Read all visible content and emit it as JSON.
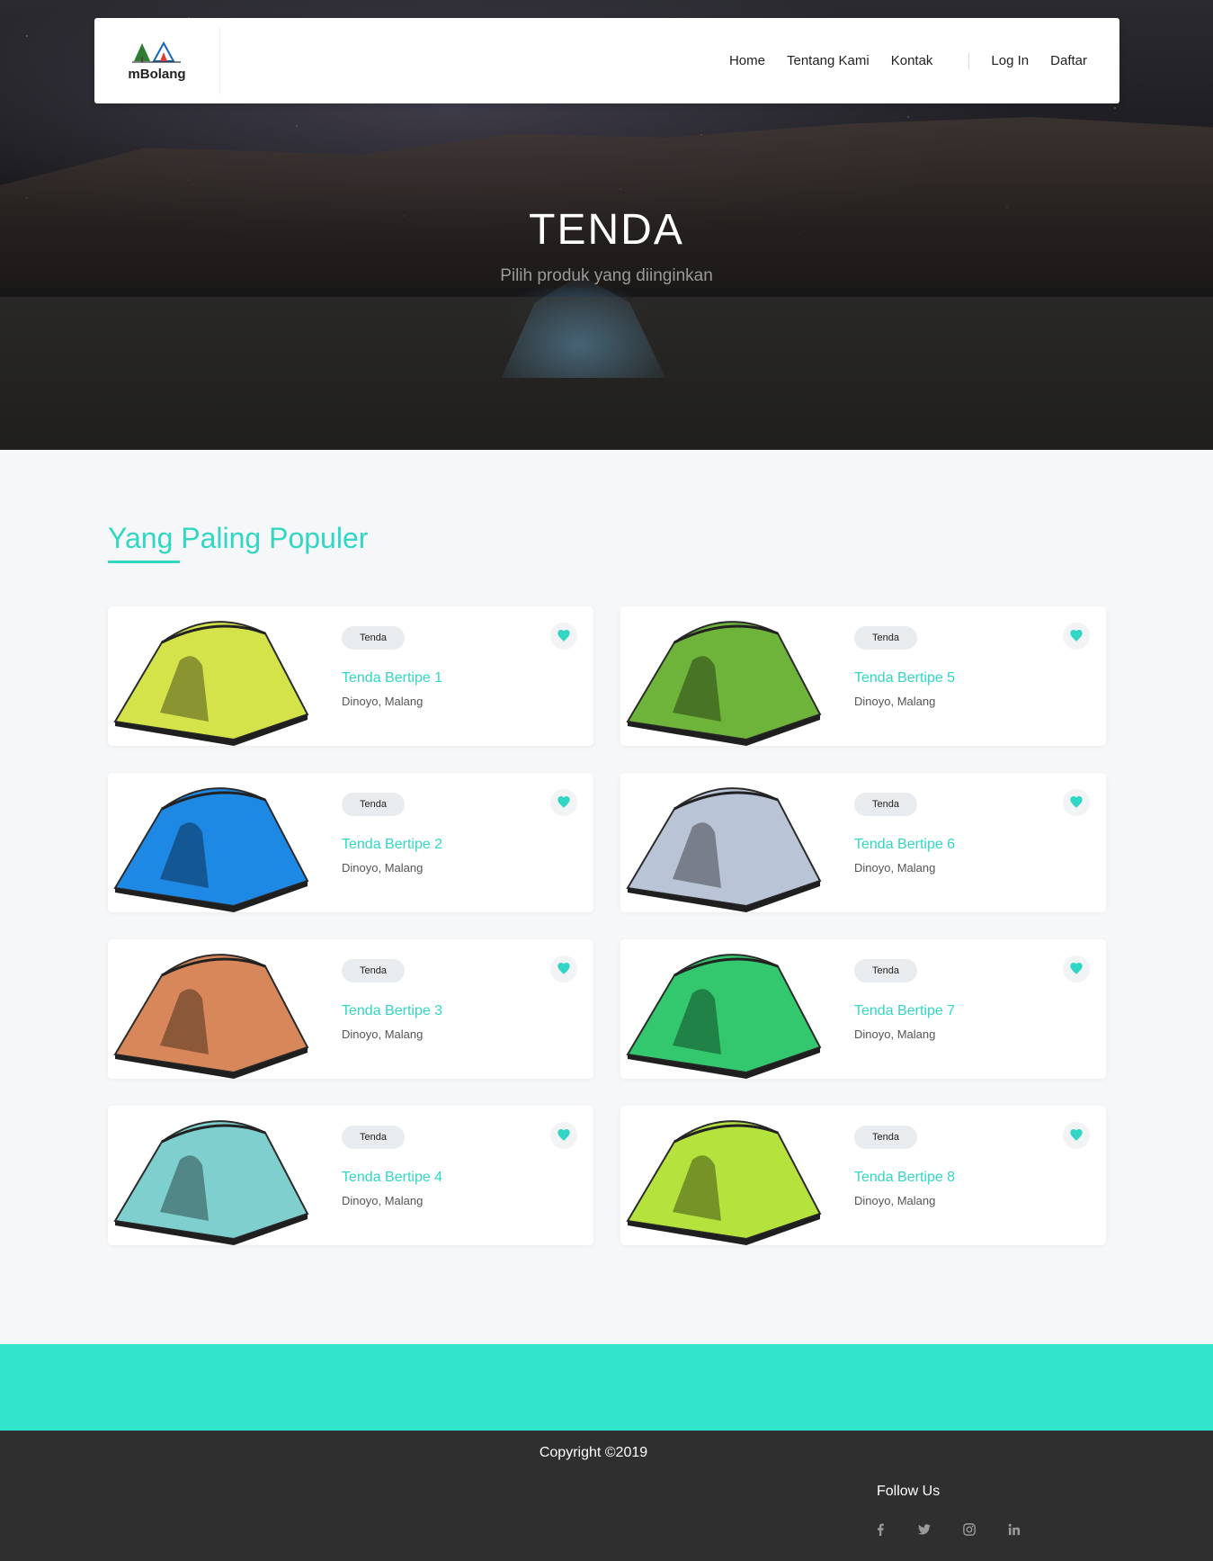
{
  "brand": {
    "name": "mBolang"
  },
  "nav": {
    "links": [
      "Home",
      "Tentang Kami",
      "Kontak"
    ],
    "login": "Log In",
    "register": "Daftar"
  },
  "hero": {
    "title": "TENDA",
    "subtitle": "Pilih produk yang diinginkan"
  },
  "popular": {
    "title": "Yang Paling Populer",
    "products": [
      {
        "badge": "Tenda",
        "name": "Tenda Bertipe 1",
        "location": "Dinoyo, Malang",
        "color": "#d5e34a"
      },
      {
        "badge": "Tenda",
        "name": "Tenda Bertipe 2",
        "location": "Dinoyo, Malang",
        "color": "#1e88e5"
      },
      {
        "badge": "Tenda",
        "name": "Tenda Bertipe 3",
        "location": "Dinoyo, Malang",
        "color": "#d7875a"
      },
      {
        "badge": "Tenda",
        "name": "Tenda Bertipe 4",
        "location": "Dinoyo, Malang",
        "color": "#7fcfcf"
      },
      {
        "badge": "Tenda",
        "name": "Tenda Bertipe 5",
        "location": "Dinoyo, Malang",
        "color": "#6fb43a"
      },
      {
        "badge": "Tenda",
        "name": "Tenda Bertipe 6",
        "location": "Dinoyo, Malang",
        "color": "#b9c4d6"
      },
      {
        "badge": "Tenda",
        "name": "Tenda Bertipe 7",
        "location": "Dinoyo, Malang",
        "color": "#34c86e"
      },
      {
        "badge": "Tenda",
        "name": "Tenda Bertipe 8",
        "location": "Dinoyo, Malang",
        "color": "#b6e23e"
      }
    ]
  },
  "footer": {
    "copyright": "Copyright ©2019",
    "follow_title": "Follow Us",
    "social": [
      "facebook-icon",
      "twitter-icon",
      "instagram-icon",
      "linkedin-icon"
    ]
  },
  "colors": {
    "accent": "#31d6c4",
    "band": "#31e5cc",
    "footer": "#2f2f30"
  }
}
